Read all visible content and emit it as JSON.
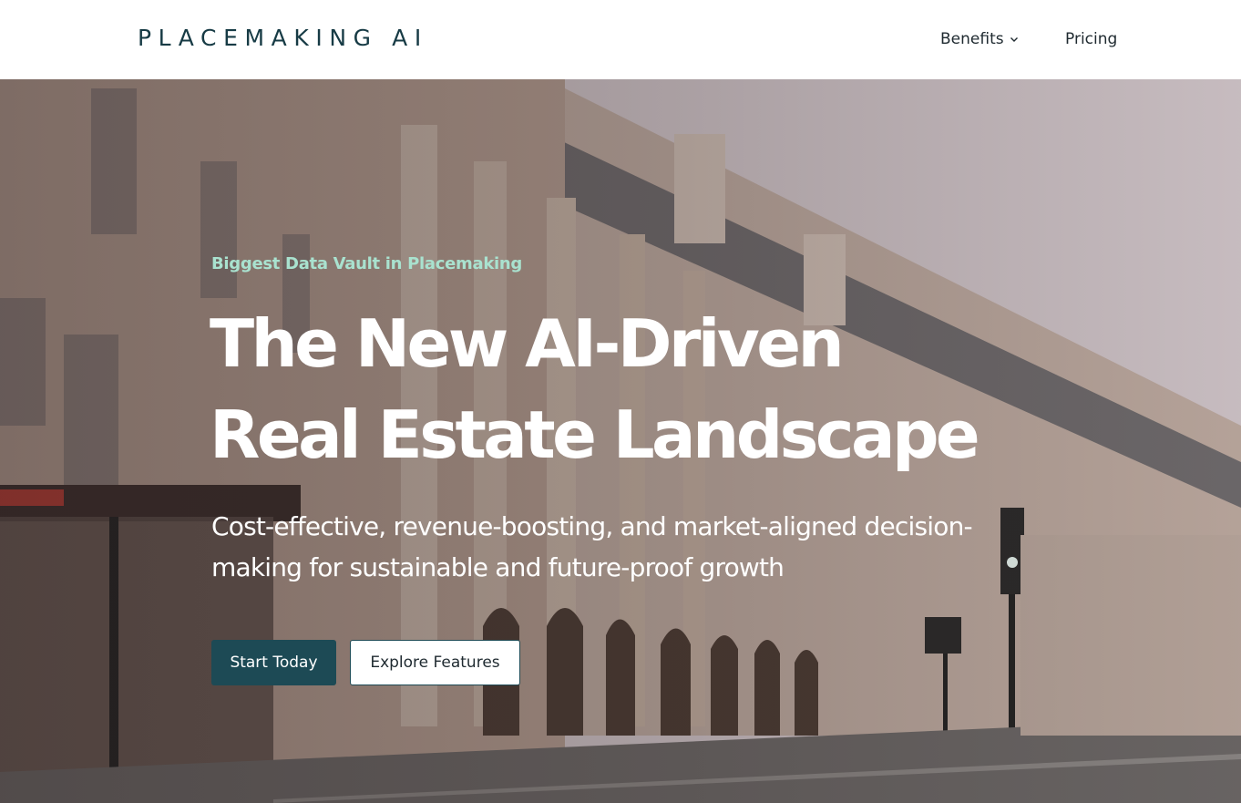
{
  "brand": {
    "logo_text": "PLACEMAKING AI"
  },
  "nav": {
    "items": [
      {
        "label": "Benefits",
        "has_dropdown": true,
        "icon": "chevron-down-icon"
      },
      {
        "label": "Pricing"
      }
    ]
  },
  "hero": {
    "eyebrow": "Biggest Data Vault in Placemaking",
    "headline_line1": "The New AI-Driven",
    "headline_line2": "Real Estate Landscape",
    "subhead": "Cost-effective, revenue-boosting, and market-aligned decision-making for sustainable and future-proof growth",
    "primary_cta": "Start Today",
    "secondary_cta": "Explore Features"
  },
  "colors": {
    "brand": "#173b45",
    "eyebrow": "#a9e2cf",
    "primary_button": "#1d4a55",
    "text_light": "#ffffff",
    "nav_text": "#1f2a30"
  }
}
